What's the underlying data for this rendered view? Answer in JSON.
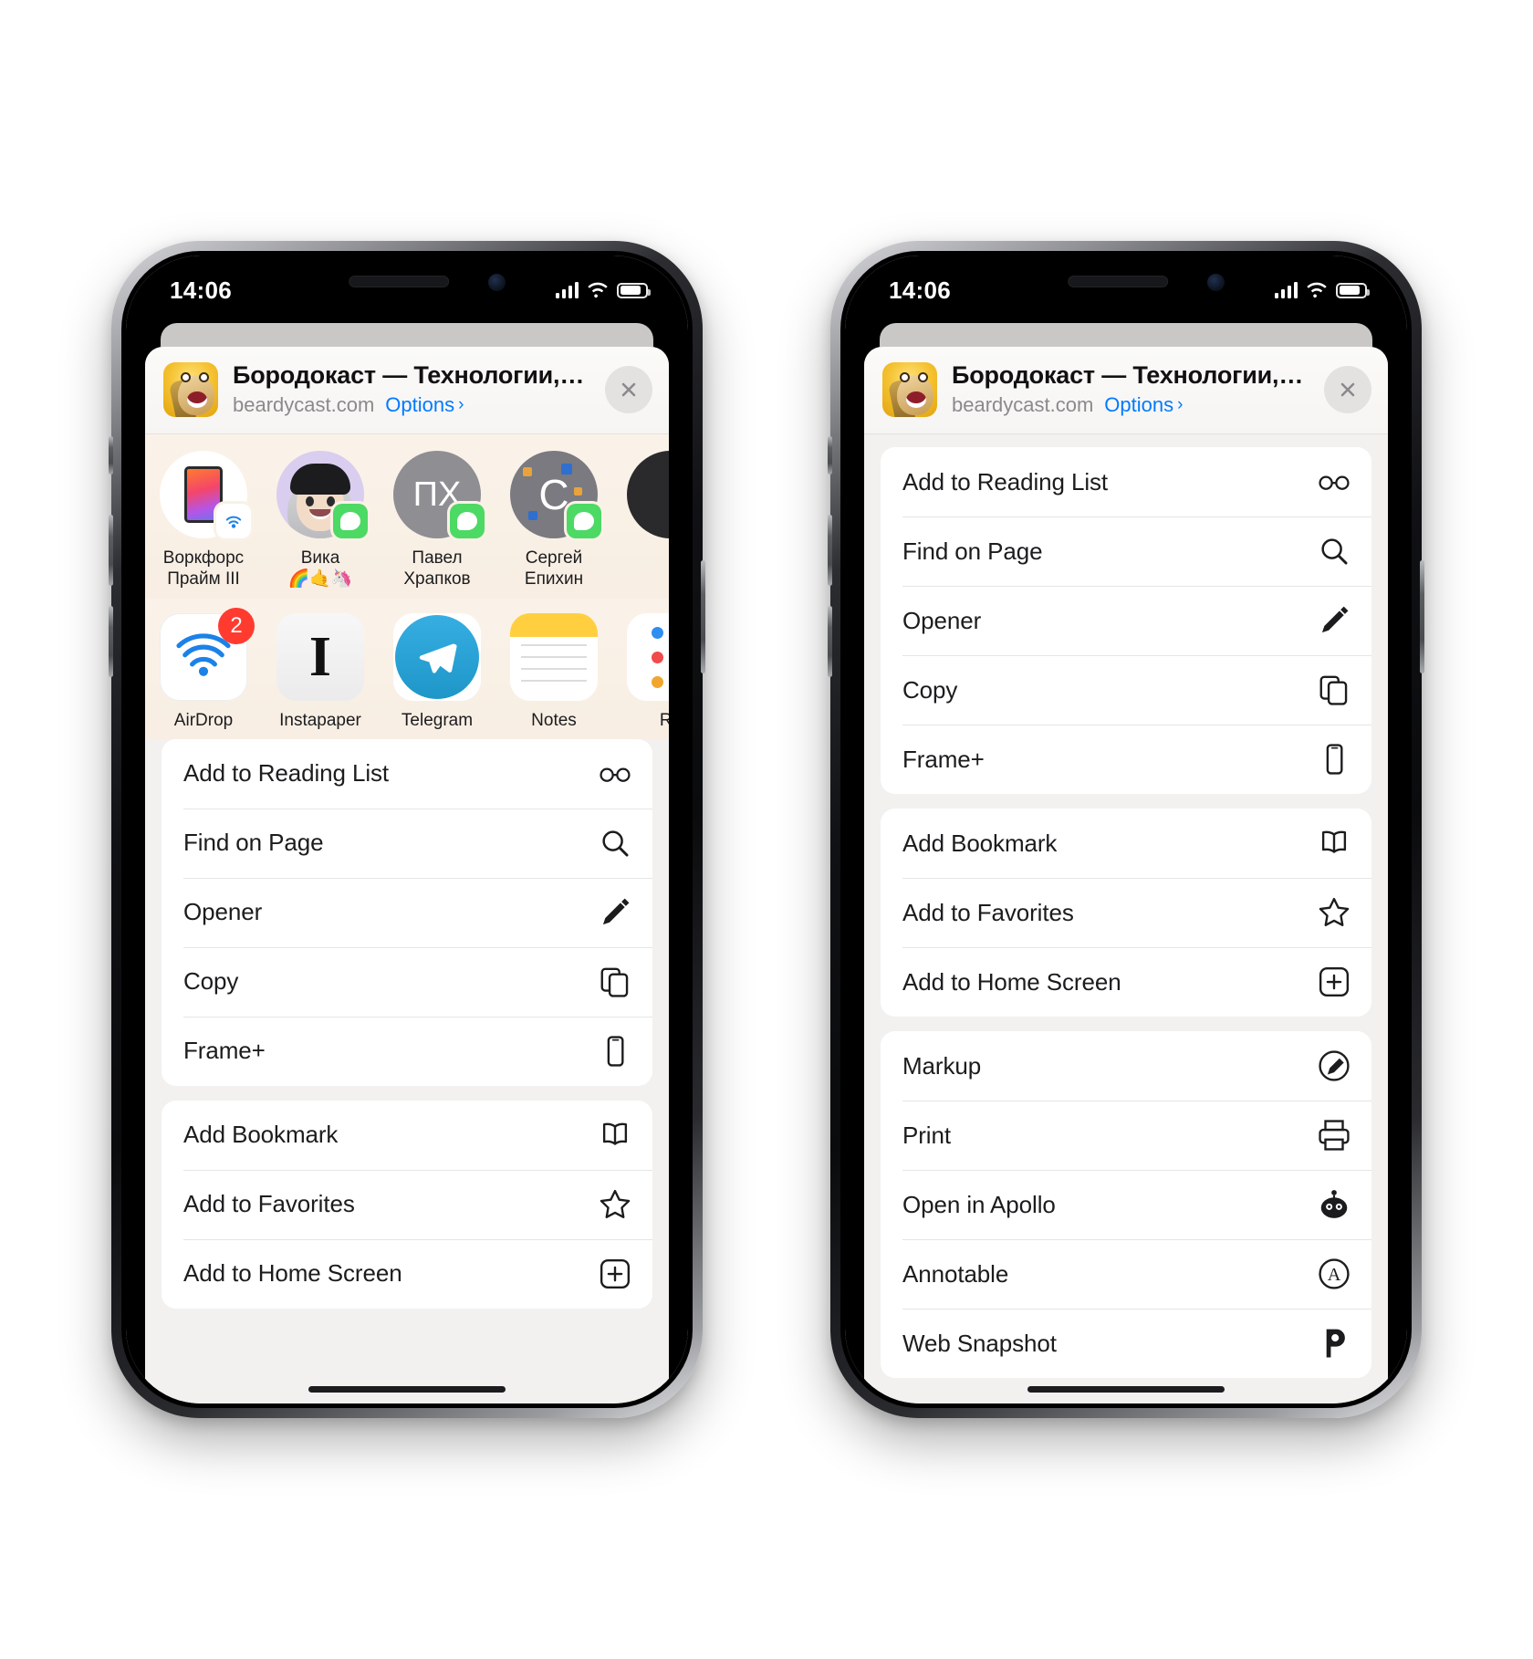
{
  "status_bar": {
    "time": "14:06",
    "signal_bars": 4,
    "battery_percent": 82
  },
  "share_sheet": {
    "title": "Бородокаст — Технологии, нау…",
    "domain": "beardycast.com",
    "options_label": "Options",
    "options_chevron": "›",
    "close_icon": "close-icon"
  },
  "contacts": [
    {
      "name": "Воркфорс\nПрайм III",
      "line1": "Воркфорс",
      "line2": "Прайм III",
      "badge": "airdrop",
      "avatar_type": "ipad"
    },
    {
      "name": "Вика 🌈🤙🦄",
      "line1": "Вика",
      "line2": "🌈🤙🦄",
      "badge": "messages",
      "avatar_type": "memoji"
    },
    {
      "name": "Павел Храпков",
      "line1": "Павел",
      "line2": "Храпков",
      "badge": "messages",
      "avatar_type": "initials",
      "initials": "ПХ"
    },
    {
      "name": "Сергей Епихин",
      "line1": "Сергей",
      "line2": "Епихин",
      "badge": "messages",
      "avatar_type": "letter",
      "initials": "C"
    },
    {
      "name": "",
      "line1": "",
      "line2": "",
      "badge": "none",
      "avatar_type": "dark"
    }
  ],
  "apps": [
    {
      "label": "AirDrop",
      "icon": "airdrop-icon",
      "badge_count": "2"
    },
    {
      "label": "Instapaper",
      "icon": "instapaper-icon",
      "badge_count": ""
    },
    {
      "label": "Telegram",
      "icon": "telegram-icon",
      "badge_count": ""
    },
    {
      "label": "Notes",
      "icon": "notes-icon",
      "badge_count": ""
    },
    {
      "label": "Re",
      "icon": "reminders-icon",
      "badge_count": ""
    }
  ],
  "action_groups": [
    {
      "items": [
        {
          "label": "Add to Reading List",
          "icon": "glasses-icon"
        },
        {
          "label": "Find on Page",
          "icon": "search-icon"
        },
        {
          "label": "Opener",
          "icon": "pencil-icon"
        },
        {
          "label": "Copy",
          "icon": "copy-icon"
        },
        {
          "label": "Frame+",
          "icon": "phone-icon"
        }
      ]
    },
    {
      "items": [
        {
          "label": "Add Bookmark",
          "icon": "book-icon"
        },
        {
          "label": "Add to Favorites",
          "icon": "star-icon"
        },
        {
          "label": "Add to Home Screen",
          "icon": "plus-square-icon"
        }
      ]
    },
    {
      "items": [
        {
          "label": "Markup",
          "icon": "markup-icon"
        },
        {
          "label": "Print",
          "icon": "printer-icon"
        },
        {
          "label": "Open in Apollo",
          "icon": "apollo-icon"
        },
        {
          "label": "Annotable",
          "icon": "annotable-icon"
        },
        {
          "label": "Web Snapshot",
          "icon": "websnapshot-icon"
        }
      ]
    }
  ],
  "left_phone": {
    "visible_action_labels": [
      "Add to Reading List",
      "Find on Page",
      "Opener",
      "Copy",
      "Frame+",
      "Add Bookmark",
      "Add to Favorites",
      "Add to Home Screen"
    ]
  },
  "colors": {
    "accent_blue": "#007aff",
    "badge_red": "#ff3b30",
    "messages_green": "#4cd964",
    "sheet_bg": "#f2f1ef",
    "row_bg": "#ffffff",
    "secondary_text": "#8a8a8e"
  }
}
